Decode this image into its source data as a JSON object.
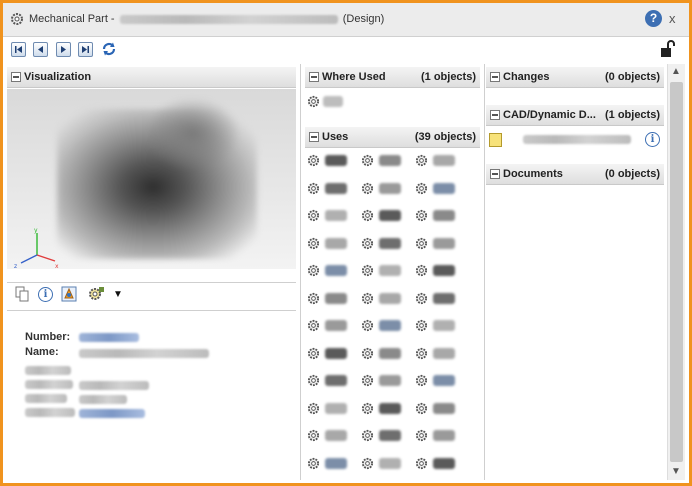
{
  "window": {
    "title_prefix": "Mechanical Part -",
    "title_suffix": "(Design)",
    "help_label": "?",
    "close_label": "x"
  },
  "icons": {
    "first": "first-page-icon",
    "prev": "previous-icon",
    "next": "next-icon",
    "last": "last-page-icon",
    "refresh": "refresh-icon",
    "lock": "unlock-icon",
    "menu": "chevron-down-icon"
  },
  "visualization": {
    "header": "Visualization",
    "axis_x": "x",
    "axis_y": "y",
    "axis_z": "z",
    "tools_menu_arrow": "▼"
  },
  "properties": {
    "number_label": "Number:",
    "name_label": "Name:"
  },
  "where_used": {
    "title": "Where Used",
    "count": "(1 objects)"
  },
  "uses": {
    "title": "Uses",
    "count": "(39 objects)"
  },
  "changes": {
    "title": "Changes",
    "count": "(0 objects)"
  },
  "cad": {
    "title": "CAD/Dynamic D...",
    "count": "(1 objects)",
    "info_label": "i"
  },
  "documents": {
    "title": "Documents",
    "count": "(0 objects)"
  },
  "colors": {
    "frame_border": "#f0931e",
    "accent_blue": "#3d6fb3"
  }
}
